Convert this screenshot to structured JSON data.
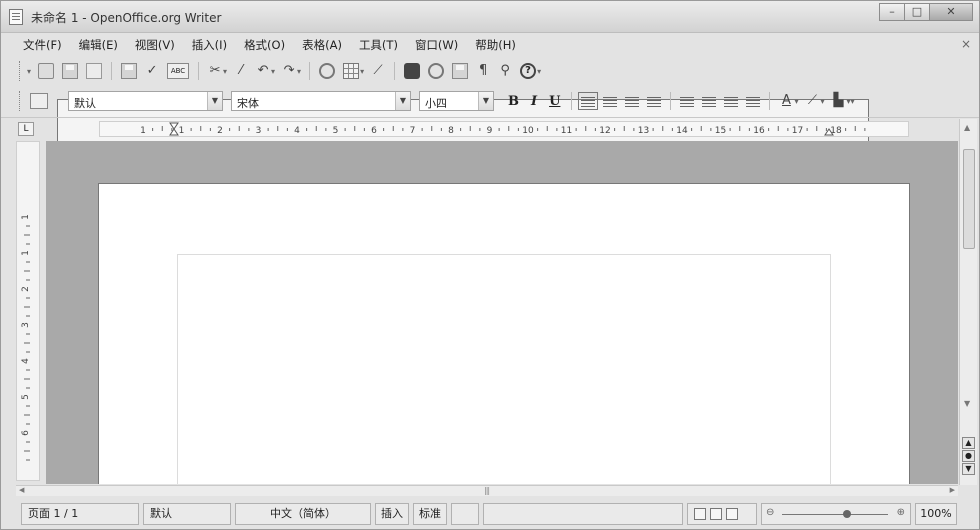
{
  "window": {
    "title": "未命名 1 - OpenOffice.org Writer",
    "buttons": [
      "minimize",
      "maximize",
      "close"
    ]
  },
  "menubar": {
    "items": [
      "文件(F)",
      "编辑(E)",
      "视图(V)",
      "插入(I)",
      "格式(O)",
      "表格(A)",
      "工具(T)",
      "窗口(W)",
      "帮助(H)"
    ],
    "close_doc": "×"
  },
  "formatting": {
    "paragraph_style": "默认",
    "font_name": "宋体",
    "font_size": "小四",
    "bold": "B",
    "italic": "I",
    "underline": "U"
  },
  "ruler": {
    "tab_button": "L",
    "ticks": [
      "1",
      "1",
      "2",
      "3",
      "4",
      "5",
      "6",
      "7",
      "8",
      "9",
      "10",
      "11",
      "12",
      "13",
      "14",
      "15",
      "16",
      "17",
      "18"
    ],
    "v_ticks": [
      "1",
      "1",
      "2",
      "3",
      "4",
      "5",
      "6"
    ]
  },
  "statusbar": {
    "page": "页面 1 / 1",
    "page_style": "默认",
    "language": "中文（简体）",
    "insert_mode": "插入",
    "selection_mode": "标准",
    "zoom": "100%",
    "zoom_level": 0.6
  },
  "icons": {
    "app": "writer-doc-icon",
    "toolbar1": [
      "new-icon",
      "open-icon",
      "save-icon",
      "email-icon",
      "edit-file-icon",
      "export-pdf-icon",
      "print-icon",
      "page-preview-icon",
      "spellcheck-icon",
      "autospellcheck-icon",
      "cut-icon",
      "copy-icon",
      "paste-icon",
      "clone-format-icon",
      "undo-icon",
      "redo-icon",
      "hyperlink-icon",
      "table-icon",
      "draw-functions-icon",
      "find-replace-icon",
      "navigator-icon",
      "gallery-icon",
      "data-sources-icon",
      "nonprinting-chars-icon",
      "zoom-icon",
      "help-icon"
    ]
  }
}
